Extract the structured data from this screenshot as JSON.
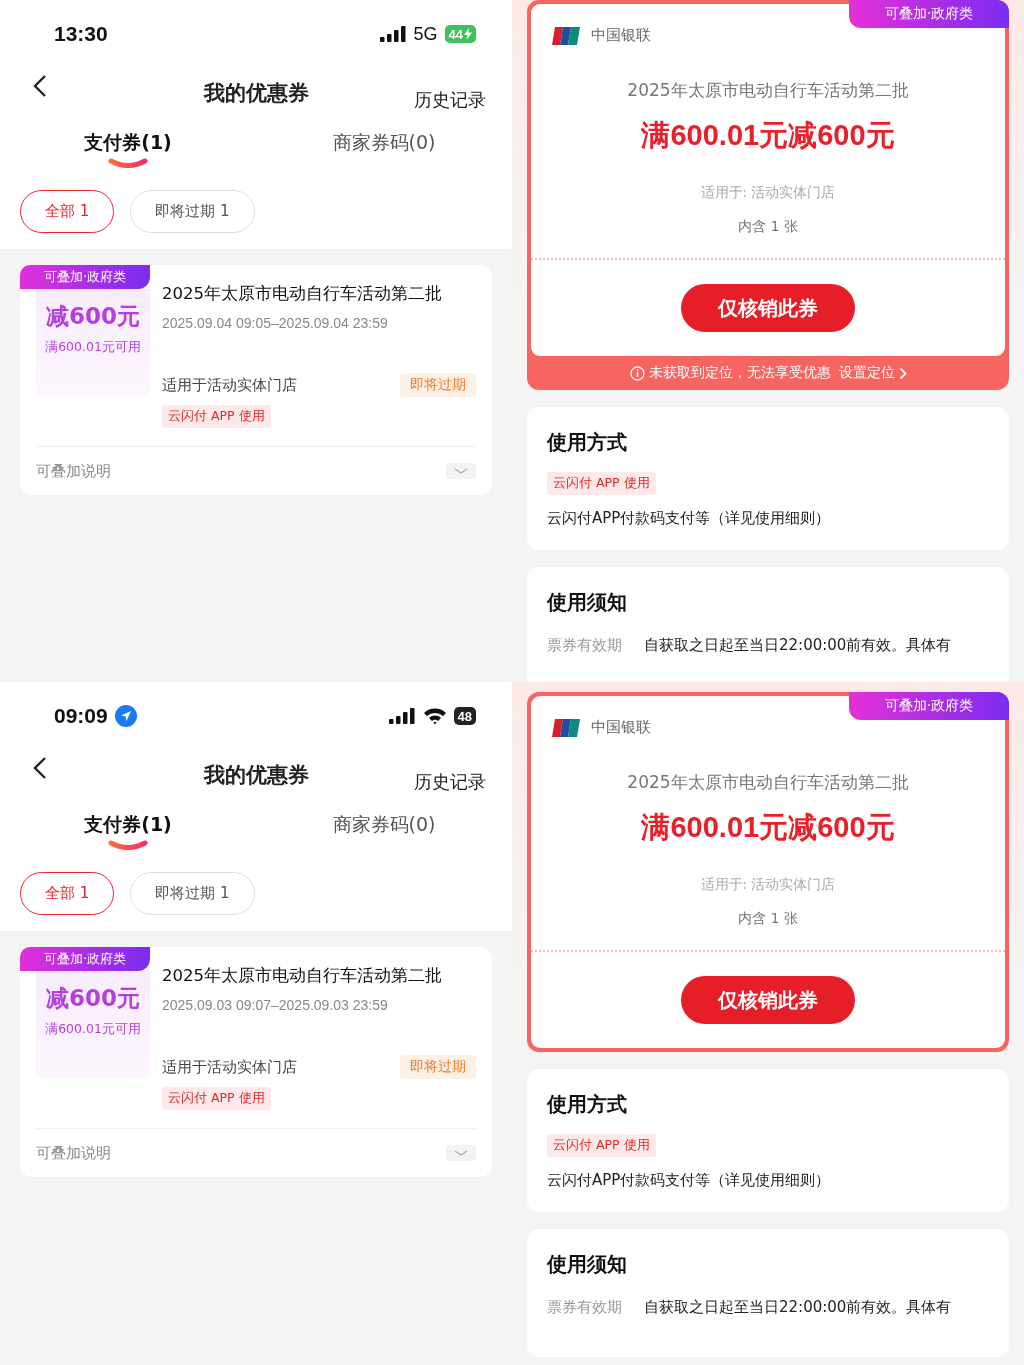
{
  "panels": [
    {
      "kind": "list",
      "status": {
        "time": "13:30",
        "location": false,
        "network": "5G",
        "wifi": false,
        "battery": "44",
        "charging": true
      },
      "title": "我的优惠券",
      "history": "历史记录",
      "tabs": [
        {
          "label": "支付券(1)",
          "selected": true
        },
        {
          "label": "商家券码(0)",
          "selected": false
        }
      ],
      "filters": [
        {
          "label": "全部 1",
          "selected": true
        },
        {
          "label": "即将过期 1",
          "selected": false
        }
      ],
      "coupon": {
        "tag": "可叠加·政府类",
        "amount": "减600元",
        "condition": "满600.01元可用",
        "name": "2025年太原市电动自行车活动第二批",
        "period": "2025.09.04 09:05–2025.09.04 23:59",
        "scope": "适用于活动实体门店",
        "badge": "即将过期",
        "channel": "云闪付 APP 使用",
        "note": "可叠加说明"
      }
    },
    {
      "kind": "detail",
      "bank": "中国银联",
      "tag": "可叠加·政府类",
      "name": "2025年太原市电动自行车活动第二批",
      "offer": "满600.01元减600元",
      "scope": "适用于: 活动实体门店",
      "count": "内含 1 张",
      "button": "仅核销此券",
      "warning": {
        "text": "未获取到定位，无法享受优惠",
        "link": "设置定位"
      },
      "usage": {
        "title": "使用方式",
        "channel": "云闪付 APP 使用",
        "text": "云闪付APP付款码支付等（详见使用细则）"
      },
      "notice": {
        "title": "使用须知",
        "label": "票券有效期",
        "text": "自获取之日起至当日22:00:00前有效。具体有"
      }
    },
    {
      "kind": "list",
      "status": {
        "time": "09:09",
        "location": true,
        "wifi": true,
        "battery": "48",
        "charging": false
      },
      "title": "我的优惠券",
      "history": "历史记录",
      "tabs": [
        {
          "label": "支付券(1)",
          "selected": true
        },
        {
          "label": "商家券码(0)",
          "selected": false
        }
      ],
      "filters": [
        {
          "label": "全部 1",
          "selected": true
        },
        {
          "label": "即将过期 1",
          "selected": false
        }
      ],
      "coupon": {
        "tag": "可叠加·政府类",
        "amount": "减600元",
        "condition": "满600.01元可用",
        "name": "2025年太原市电动自行车活动第二批",
        "period": "2025.09.03 09:07–2025.09.03 23:59",
        "scope": "适用于活动实体门店",
        "badge": "即将过期",
        "channel": "云闪付 APP 使用",
        "note": "可叠加说明"
      }
    },
    {
      "kind": "detail",
      "bank": "中国银联",
      "tag": "可叠加·政府类",
      "name": "2025年太原市电动自行车活动第二批",
      "offer": "满600.01元减600元",
      "scope": "适用于: 活动实体门店",
      "count": "内含 1 张",
      "button": "仅核销此券",
      "usage": {
        "title": "使用方式",
        "channel": "云闪付 APP 使用",
        "text": "云闪付APP付款码支付等（详见使用细则）"
      },
      "notice": {
        "title": "使用须知",
        "label": "票券有效期",
        "text": "自获取之日起至当日22:00:00前有效。具体有"
      }
    }
  ]
}
